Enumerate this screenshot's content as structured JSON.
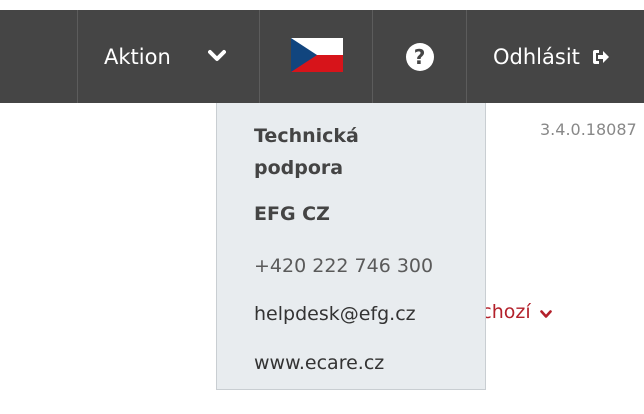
{
  "navbar": {
    "action_label": "Aktion",
    "logout_label": "Odhlásit",
    "help_symbol": "?",
    "language_flag": "cz-flag-icon",
    "background_color": "#454545"
  },
  "version": "3.4.0.18087",
  "default_link": {
    "label": "ýchozí",
    "color": "#b3202a"
  },
  "support_dropdown": {
    "title": "Technická podpora",
    "company": "EFG CZ",
    "phone": "+420 222 746 300",
    "email": "helpdesk@efg.cz",
    "website": "www.ecare.cz"
  }
}
